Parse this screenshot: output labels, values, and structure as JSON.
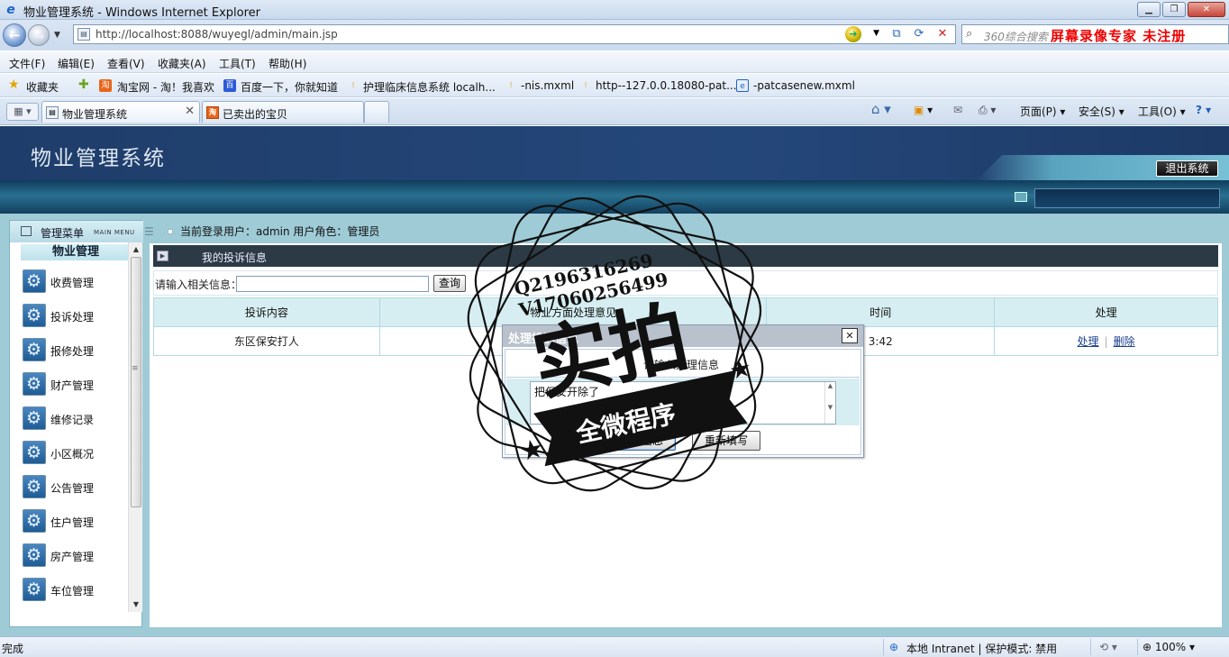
{
  "browser": {
    "window_title": "物业管理系统 - Windows Internet Explorer",
    "url": "http://localhost:8088/wuyegl/admin/main.jsp",
    "search_placeholder": "360综合搜索",
    "recorder_text": "屏幕录像专家  未注册",
    "menu": [
      "文件(F)",
      "编辑(E)",
      "查看(V)",
      "收藏夹(A)",
      "工具(T)",
      "帮助(H)"
    ],
    "favorites_label": "收藏夹",
    "favorites": [
      "淘宝网 - 淘！我喜欢",
      "百度一下，你就知道",
      "护理临床信息系统 localh...",
      "-nis.mxml",
      "http--127.0.0.18080-pat...",
      "-patcasenew.mxml"
    ],
    "tabs": [
      {
        "label": "物业管理系统",
        "active": true
      },
      {
        "label": "已卖出的宝贝",
        "active": false
      }
    ],
    "toolbar": {
      "page": "页面(P)",
      "safety": "安全(S)",
      "tools": "工具(O)"
    },
    "status": {
      "left": "完成",
      "zone": "本地 Intranet | 保护模式: 禁用",
      "zoom": "100%"
    }
  },
  "app": {
    "system_name": "物业管理系统",
    "logout": "退出系统",
    "sidebar": {
      "header": "管理菜单",
      "header_sub": "MAIN MENU",
      "group": "物业管理",
      "items": [
        {
          "label": "收费管理"
        },
        {
          "label": "投诉处理"
        },
        {
          "label": "报修处理"
        },
        {
          "label": "财产管理"
        },
        {
          "label": "维修记录"
        },
        {
          "label": "小区概况"
        },
        {
          "label": "公告管理"
        },
        {
          "label": "住户管理"
        },
        {
          "label": "房产管理"
        },
        {
          "label": "车位管理"
        }
      ]
    },
    "login_info": "当前登录用户：admin 用户角色：管理员",
    "content_title": "我的投诉信息",
    "search": {
      "label": "请输入相关信息：",
      "button": "查询"
    },
    "table": {
      "headers": [
        "投诉内容",
        "物业方面处理意见",
        "时间",
        "处理"
      ],
      "rows": [
        {
          "content": "东区保安打人",
          "opinion": "",
          "time": "3:42",
          "action_edit": "处理",
          "action_delete": "删除"
        }
      ]
    }
  },
  "dialog": {
    "title": "处理投诉信息",
    "heading": "请输入处理信息",
    "textarea_value": "把保安开除了",
    "submit": "提交信息",
    "reset": "重新填写"
  },
  "watermark": {
    "line1": "Q2196316269",
    "line2": "V17060256499",
    "big": "实拍",
    "ribbon": "全微程序"
  }
}
